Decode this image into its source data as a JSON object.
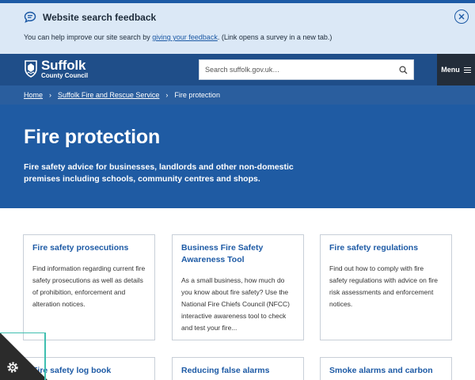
{
  "feedback_banner": {
    "title": "Website search feedback",
    "text_before": "You can help improve our site search by ",
    "link_text": "giving your feedback",
    "text_after": ". (Link opens a survey in a new tab.)",
    "icons": {
      "message": "chat-bubble-icon",
      "close": "close-circle-icon"
    }
  },
  "header": {
    "logo_name": "Suffolk",
    "logo_sub": "County Council",
    "search_placeholder": "Search suffolk.gov.uk…",
    "menu_label": "Menu",
    "icons": {
      "search": "magnifier-icon",
      "menu": "hamburger-icon"
    }
  },
  "breadcrumb": {
    "items": [
      {
        "label": "Home"
      },
      {
        "label": "Suffolk Fire and Rescue Service"
      },
      {
        "label": "Fire protection"
      }
    ],
    "separator": "›"
  },
  "hero": {
    "title": "Fire protection",
    "intro": "Fire safety advice for businesses, landlords and other non-domestic premises including schools, community centres and shops."
  },
  "cards": [
    {
      "title": "Fire safety prosecutions",
      "description": "Find information regarding current fire safety prosecutions as well as details of prohibition, enforcement and alteration notices."
    },
    {
      "title": "Business Fire Safety Awareness Tool",
      "description": "As a small business, how much do you know about fire safety? Use the National Fire Chiefs Council (NFCC) interactive awareness tool to check and test your fire..."
    },
    {
      "title": "Fire safety regulations",
      "description": "Find out how to comply with fire safety regulations with advice on fire risk assessments and enforcement notices."
    },
    {
      "title": "Fire safety log book",
      "description": ""
    },
    {
      "title": "Reducing false alarms",
      "description": ""
    },
    {
      "title": "Smoke alarms and carbon",
      "description": ""
    }
  ],
  "cookie_settings": {
    "icon": "gear-icon"
  },
  "colors": {
    "banner_bg": "#dbe8f6",
    "header_bg": "#1f4e89",
    "breadcrumb_bg": "#2a5e9e",
    "hero_bg": "#1f5ba3",
    "link": "#1d5aa5",
    "menu_bg": "#232d3a"
  }
}
